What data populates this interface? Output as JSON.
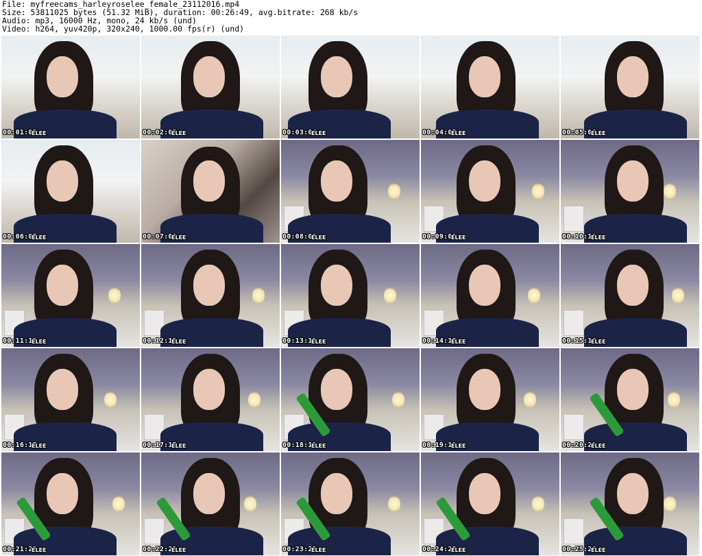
{
  "header": {
    "file": "File: myfreecams_harleyroselee_female_23112016.mp4",
    "size": "Size: 53811025 bytes (51.32 MiB), duration: 00:26:49, avg.bitrate: 268 kb/s",
    "audio": "Audio: mp3, 16000 Hz, mono, 24 kb/s (und)",
    "video": "Video: h264, yuv420p, 320x240, 1000.00 fps(r) (und)"
  },
  "thumbnails": [
    {
      "time": "00:01:02",
      "variant": "bright"
    },
    {
      "time": "00:02:03",
      "variant": "bright"
    },
    {
      "time": "00:03:04",
      "variant": "bright"
    },
    {
      "time": "00:04:05",
      "variant": "bright"
    },
    {
      "time": "00:05:06",
      "variant": "bright"
    },
    {
      "time": "00:06:07",
      "variant": "bright"
    },
    {
      "time": "00:07:08",
      "variant": "blurry"
    },
    {
      "time": "00:08:08",
      "variant": "room"
    },
    {
      "time": "00:09:09",
      "variant": "room"
    },
    {
      "time": "00:10:10",
      "variant": "room"
    },
    {
      "time": "00:11:12",
      "variant": "room"
    },
    {
      "time": "00:12:13",
      "variant": "room"
    },
    {
      "time": "00:13:13",
      "variant": "room"
    },
    {
      "time": "00:14:15",
      "variant": "room"
    },
    {
      "time": "00:15:16",
      "variant": "room"
    },
    {
      "time": "00:16:17",
      "variant": "room"
    },
    {
      "time": "00:17:17",
      "variant": "room"
    },
    {
      "time": "00:18:19",
      "variant": "room"
    },
    {
      "time": "00:19:19",
      "variant": "room"
    },
    {
      "time": "00:20:21",
      "variant": "room"
    },
    {
      "time": "00:21:22",
      "variant": "room"
    },
    {
      "time": "00:22:23",
      "variant": "room"
    },
    {
      "time": "00:23:23",
      "variant": "room"
    },
    {
      "time": "00:24:25",
      "variant": "room"
    },
    {
      "time": "00:25:26",
      "variant": "room"
    }
  ],
  "watermark": "ELEE",
  "colors": {
    "background": "#ffffff",
    "stamp_text": "#ffffff",
    "stamp_outline": "#000000",
    "sweater": "#1b2446",
    "hair": "#1f1816",
    "ukulele": "#2d9a3a"
  }
}
